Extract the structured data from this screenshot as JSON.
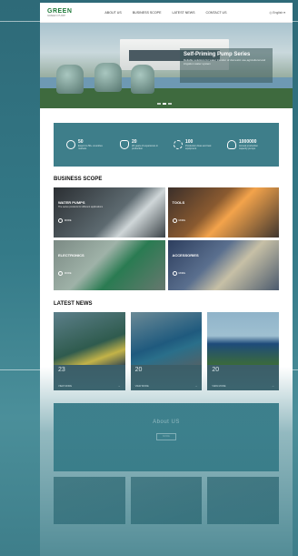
{
  "header": {
    "logo_text": "GREEN",
    "logo_tagline": "GREEN PUMP",
    "nav": [
      "ABOUT US",
      "BUSINESS SCOPE",
      "LATEST NEWS",
      "CONTACT US"
    ],
    "language": "English"
  },
  "hero": {
    "title": "Self-Priming Pump Series",
    "subtitle": "Reliable solutions for water transfer of domestic use,agricultural and irrigation water system"
  },
  "stats": [
    {
      "icon": "globe-icon",
      "number": "50",
      "desc": "Export to 50+ countries markets"
    },
    {
      "icon": "shield-check-icon",
      "number": "20",
      "desc": "20 years of experience in production"
    },
    {
      "icon": "gears-icon",
      "number": "100",
      "desc": "Production lines and test equipment"
    },
    {
      "icon": "lightbulb-icon",
      "number": "1000000",
      "desc": "Annual production capacity pumps"
    }
  ],
  "business": {
    "heading": "BUSINESS SCOPE",
    "tiles": [
      {
        "label": "WATER PUMPS",
        "sub": "The series products for different applications",
        "more": "MORE"
      },
      {
        "label": "TOOLS",
        "sub": "",
        "more": "MORE"
      },
      {
        "label": "ELECTRONICS",
        "sub": "",
        "more": "MORE"
      },
      {
        "label": "ACCESSORIES",
        "sub": "",
        "more": "MORE"
      }
    ]
  },
  "news": {
    "heading": "LATEST NEWS",
    "items": [
      {
        "date": "23",
        "desc": "",
        "more": "VIEW MORE"
      },
      {
        "date": "20",
        "desc": "",
        "more": "VIEW MORE"
      },
      {
        "date": "20",
        "desc": "",
        "more": "VIEW MORE"
      }
    ]
  },
  "about": {
    "heading": "About US",
    "text": "",
    "more": "MORE"
  },
  "bottom": [
    "",
    "",
    ""
  ]
}
